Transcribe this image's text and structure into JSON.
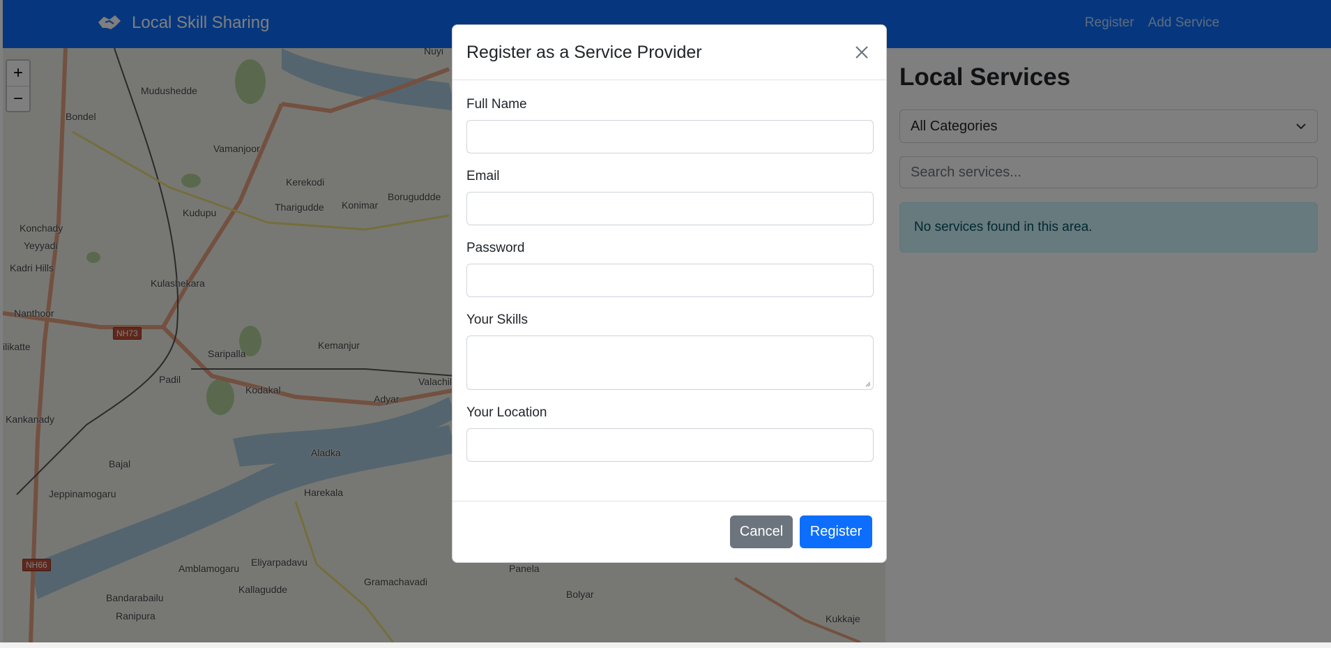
{
  "navbar": {
    "brand": "Local Skill Sharing",
    "links": {
      "register": "Register",
      "add_service": "Add Service"
    }
  },
  "map": {
    "zoom_in": "+",
    "zoom_out": "−",
    "labels": {
      "mudushedde": "Mudushedde",
      "bondel": "Bondel",
      "vamanjoor": "Vamanjoor",
      "kerekodi": "Kerekodi",
      "kudupu": "Kudupu",
      "tharigudde": "Tharigudde",
      "konimar": "Konimar",
      "boruguddde": "Boruguddde",
      "konchady": "Konchady",
      "yeyyadi": "Yeyyadi",
      "kadri_hills": "Kadri Hills",
      "kulashekara": "Kulashekara",
      "nanthoor": "Nanthoor",
      "nh73": "NH73",
      "ilikatte": "ilikatte",
      "saripalla": "Saripalla",
      "kemanjur": "Kemanjur",
      "padil": "Padil",
      "kodakal": "Kodakal",
      "adyar": "Adyar",
      "valachil": "Valachil",
      "kankanady": "Kankanady",
      "bajal": "Bajal",
      "aladka": "Aladka",
      "harekala": "Harekala",
      "jeppinamogaru": "Jeppinamogaru",
      "nh66": "NH66",
      "amblamogaru": "Amblamogaru",
      "eliyarpadavu": "Eliyarpadavu",
      "kallagudde": "Kallagudde",
      "gramachavadi": "Gramachavadi",
      "panela": "Panela",
      "bolyar": "Bolyar",
      "bandarabailu": "Bandarabailu",
      "ranipura": "Ranipura",
      "kukkaje": "Kukkaje",
      "nuyi": "Nuyi"
    }
  },
  "panel": {
    "title": "Local Services",
    "category_select": "All Categories",
    "search_placeholder": "Search services...",
    "empty_message": "No services found in this area."
  },
  "modal": {
    "title": "Register as a Service Provider",
    "fields": {
      "full_name": "Full Name",
      "email": "Email",
      "password": "Password",
      "skills": "Your Skills",
      "location": "Your Location"
    },
    "buttons": {
      "cancel": "Cancel",
      "register": "Register"
    }
  },
  "colors": {
    "primary": "#0d6efd",
    "secondary": "#6c757d",
    "alert_bg": "#cff4fc",
    "alert_text": "#055160"
  }
}
